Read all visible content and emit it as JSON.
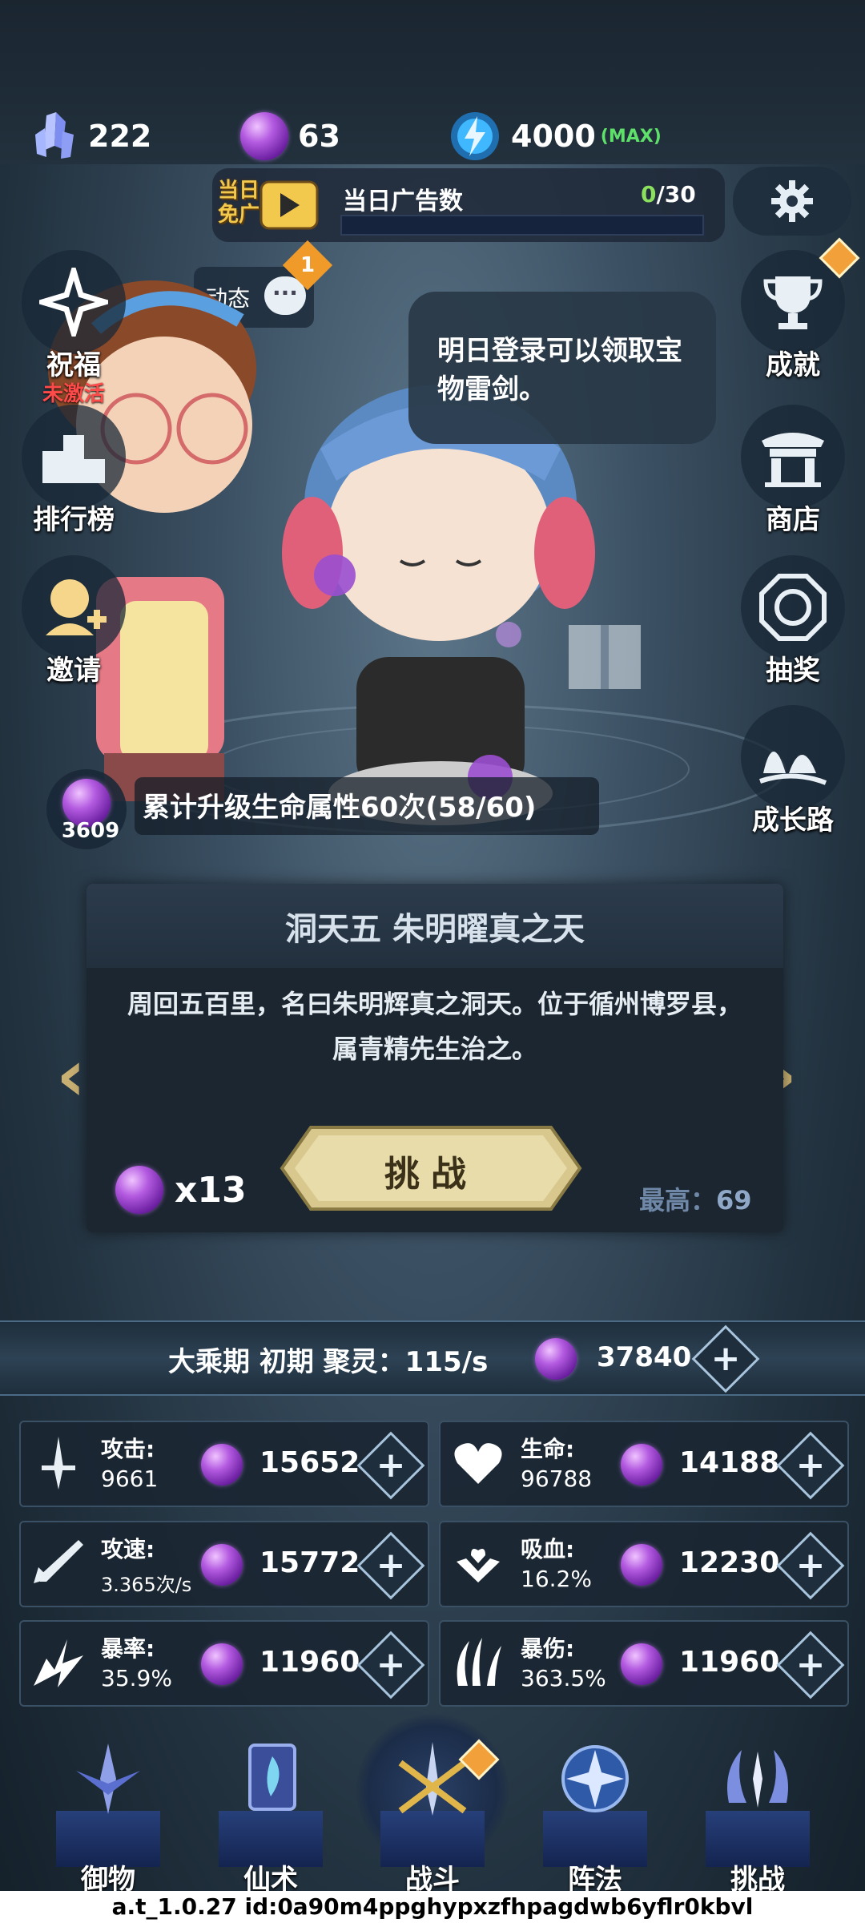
{
  "resources": {
    "crystal": {
      "icon": "crystal-icon",
      "value": "222"
    },
    "orb": {
      "icon": "purple-orb-icon",
      "value": "63"
    },
    "energy": {
      "icon": "energy-icon",
      "value": "4000",
      "max_label": "(MAX)"
    }
  },
  "ad_bar": {
    "badge_line1": "当日",
    "badge_line2": "免广",
    "title": "当日广告数",
    "count_current": "0",
    "count_total": "/30",
    "progress": 0.0
  },
  "news": {
    "label": "动态",
    "badge": "1"
  },
  "left_menu": [
    {
      "name": "blessing",
      "label": "祝福",
      "sub": "未激活"
    },
    {
      "name": "ranking",
      "label": "排行榜"
    },
    {
      "name": "invite",
      "label": "邀请"
    }
  ],
  "right_menu": [
    {
      "name": "achievement",
      "label": "成就"
    },
    {
      "name": "shop",
      "label": "商店"
    },
    {
      "name": "lottery",
      "label": "抽奖"
    },
    {
      "name": "growth",
      "label": "成长路"
    }
  ],
  "speech": "明日登录可以领取宝物雷剑。",
  "quest": {
    "reward": "3609",
    "text": "累计升级生命属性60次(58/60)"
  },
  "stage": {
    "title": "洞天五 朱明曜真之天",
    "description": "周回五百里，名曰朱明辉真之洞天。位于循州博罗县，属青精先生治之。",
    "cost": "x13",
    "challenge_label": "挑战",
    "best_label": "最高：",
    "best_value": "69"
  },
  "realm": {
    "text": "大乘期 初期 聚灵：115/s",
    "orbs": "37840"
  },
  "stats": [
    {
      "name": "attack",
      "label": "攻击:",
      "value": "9661",
      "cost": "15652",
      "icon": "sword-icon"
    },
    {
      "name": "hp",
      "label": "生命:",
      "value": "96788",
      "cost": "14188",
      "icon": "heart-icon"
    },
    {
      "name": "attack-speed",
      "label": "攻速:",
      "value": "3.365次/s",
      "cost": "15772",
      "icon": "dagger-icon"
    },
    {
      "name": "lifesteal",
      "label": "吸血:",
      "value": "16.2%",
      "cost": "12230",
      "icon": "lifesteal-icon"
    },
    {
      "name": "crit-rate",
      "label": "暴率:",
      "value": "35.9%",
      "cost": "11960",
      "icon": "crit-icon"
    },
    {
      "name": "crit-damage",
      "label": "暴伤:",
      "value": "363.5%",
      "cost": "11960",
      "icon": "claw-icon"
    }
  ],
  "nav": [
    {
      "name": "treasure",
      "label": "御物"
    },
    {
      "name": "spell",
      "label": "仙术"
    },
    {
      "name": "battle",
      "label": "战斗"
    },
    {
      "name": "formation",
      "label": "阵法"
    },
    {
      "name": "challenge",
      "label": "挑战"
    }
  ],
  "footer": "a.t_1.0.27 id:0a90m4ppghypxzfhpagdwb6yflr0kbvl"
}
